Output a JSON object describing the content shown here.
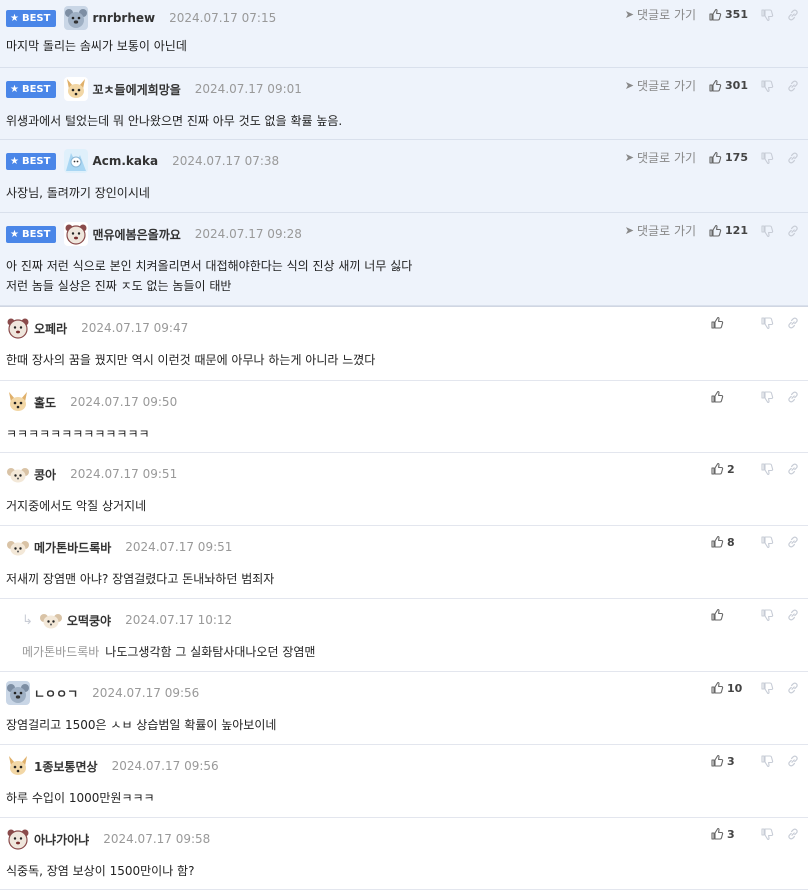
{
  "ui": {
    "best_label": "BEST",
    "reply_label": "댓글로 가기"
  },
  "comments": [
    {
      "best": true,
      "avatar": "koala",
      "nick": "rnrbrhew",
      "date": "2024.07.17 07:15",
      "likes": "351",
      "lines": [
        "마지막 돌리는 솜씨가 보통이 아닌데"
      ]
    },
    {
      "best": true,
      "avatar": "fox",
      "nick": "꼬ㅊ들에게희망을",
      "date": "2024.07.17 09:01",
      "likes": "301",
      "lines": [
        "위생과에서 털었는데 뭐 안나왔으면 진짜 아무 것도 없을 확률 높음."
      ]
    },
    {
      "best": true,
      "avatar": "ice",
      "nick": "Acm.kaka",
      "date": "2024.07.17 07:38",
      "likes": "175",
      "lines": [
        "사장님, 돌려까기 장인이시네"
      ]
    },
    {
      "best": true,
      "avatar": "bear",
      "nick": "맨유에봄은올까요",
      "date": "2024.07.17 09:28",
      "likes": "121",
      "lines": [
        "아 진짜 저런 식으로 본인 치켜올리면서 대접해야한다는 식의 진상 새끼 너무 싫다",
        "저런 놈들 실상은 진짜 ㅈ도 없는 놈들이 태반"
      ]
    },
    {
      "best": false,
      "avatar": "bear",
      "nick": "오페라",
      "date": "2024.07.17 09:47",
      "likes": "",
      "lines": [
        "한때 장사의 꿈을 꿨지만 역시 이런것 때문에 아무나 하는게 아니라 느꼈다"
      ]
    },
    {
      "best": false,
      "avatar": "fox",
      "nick": "홀도",
      "date": "2024.07.17 09:50",
      "likes": "",
      "lines": [
        "ㅋㅋㅋㅋㅋㅋㅋㅋㅋㅋㅋㅋㅋ"
      ]
    },
    {
      "best": false,
      "avatar": "mouse",
      "nick": "콩아",
      "date": "2024.07.17 09:51",
      "likes": "2",
      "lines": [
        "거지중에서도 악질 상거지네"
      ]
    },
    {
      "best": false,
      "avatar": "mouse",
      "nick": "메가톤바드록바",
      "date": "2024.07.17 09:51",
      "likes": "8",
      "lines": [
        "저새끼 장염맨 아냐? 장염걸렸다고 돈내놔하던 범죄자"
      ]
    },
    {
      "best": false,
      "reply": true,
      "avatar": "mouse",
      "nick": "오떡쿵야",
      "date": "2024.07.17 10:12",
      "likes": "",
      "mention": "메가톤바드록바",
      "lines": [
        "나도그생각함 그 실화탐사대나오던 장염맨"
      ]
    },
    {
      "best": false,
      "avatar": "koala",
      "nick": "ㄴㅇㅇㄱ",
      "date": "2024.07.17 09:56",
      "likes": "10",
      "lines": [
        "장염걸리고 1500은 ㅅㅂ 상습범일 확률이 높아보이네"
      ]
    },
    {
      "best": false,
      "avatar": "fox",
      "nick": "1종보통면상",
      "date": "2024.07.17 09:56",
      "likes": "3",
      "lines": [
        "하루 수입이 1000만원ㅋㅋㅋ"
      ]
    },
    {
      "best": false,
      "avatar": "bear",
      "nick": "아냐가아냐",
      "date": "2024.07.17 09:58",
      "likes": "3",
      "lines": [
        "식중독, 장염 보상이 1500만이나 함?"
      ]
    }
  ]
}
